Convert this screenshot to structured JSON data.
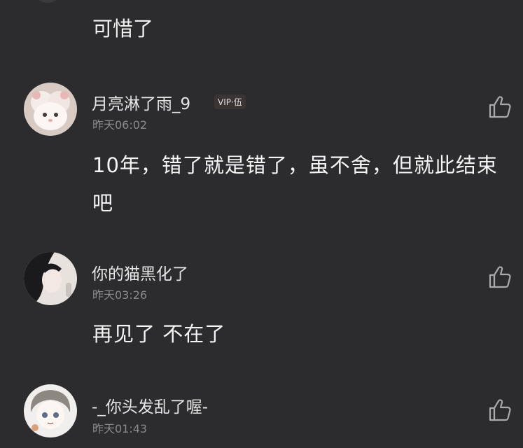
{
  "comments": [
    {
      "body": "可惜了"
    },
    {
      "username": "月亮淋了雨_9",
      "vip_badge": "VIP·伍",
      "time": "昨天06:02",
      "body": "10年，错了就是错了，虽不舍，但就此结束吧"
    },
    {
      "username": "你的猫黑化了",
      "time": "昨天03:26",
      "body": "再见了 不在了"
    },
    {
      "username": "-_你头发乱了喔-",
      "time": "昨天01:43"
    }
  ],
  "icons": {
    "like": "thumbs-up-icon"
  },
  "colors": {
    "background": "#2c2c2e",
    "text_primary": "#f5f5f5",
    "text_secondary": "#8a8a8e",
    "vip_badge_text": "#e0dcd8"
  }
}
